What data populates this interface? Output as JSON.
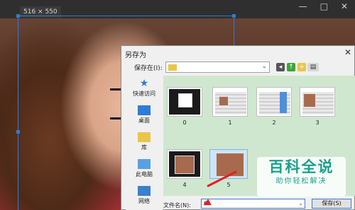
{
  "canvas": {
    "size_label": "516 × 550"
  },
  "window_controls": [
    "—",
    "□",
    "✕"
  ],
  "dialog": {
    "title": "另存为",
    "close": "✕",
    "save_in_label": "保存在(I):",
    "toolbar_icons": [
      "back-icon",
      "up-folder-icon",
      "new-folder-icon",
      "view-menu-icon"
    ],
    "places": [
      {
        "label": "快速访问",
        "icon": "star-icon"
      },
      {
        "label": "桌面",
        "icon": "desktop-icon"
      },
      {
        "label": "库",
        "icon": "library-icon"
      },
      {
        "label": "此电脑",
        "icon": "computer-icon"
      },
      {
        "label": "网络",
        "icon": "network-icon"
      }
    ],
    "files": [
      {
        "name": "0"
      },
      {
        "name": "1"
      },
      {
        "name": "2"
      },
      {
        "name": "3"
      },
      {
        "name": "4"
      },
      {
        "name": "5"
      }
    ],
    "filename_label": "文件名(N):",
    "filename_value": "6",
    "save_button": "保存(S)"
  },
  "watermark": {
    "title": "百科全说",
    "subtitle": "助你轻松解决"
  },
  "colors": {
    "accent": "#2f7bd8",
    "file_area": "#cfe7cf",
    "watermark": "#1aa08c",
    "arrow": "#e02020"
  }
}
